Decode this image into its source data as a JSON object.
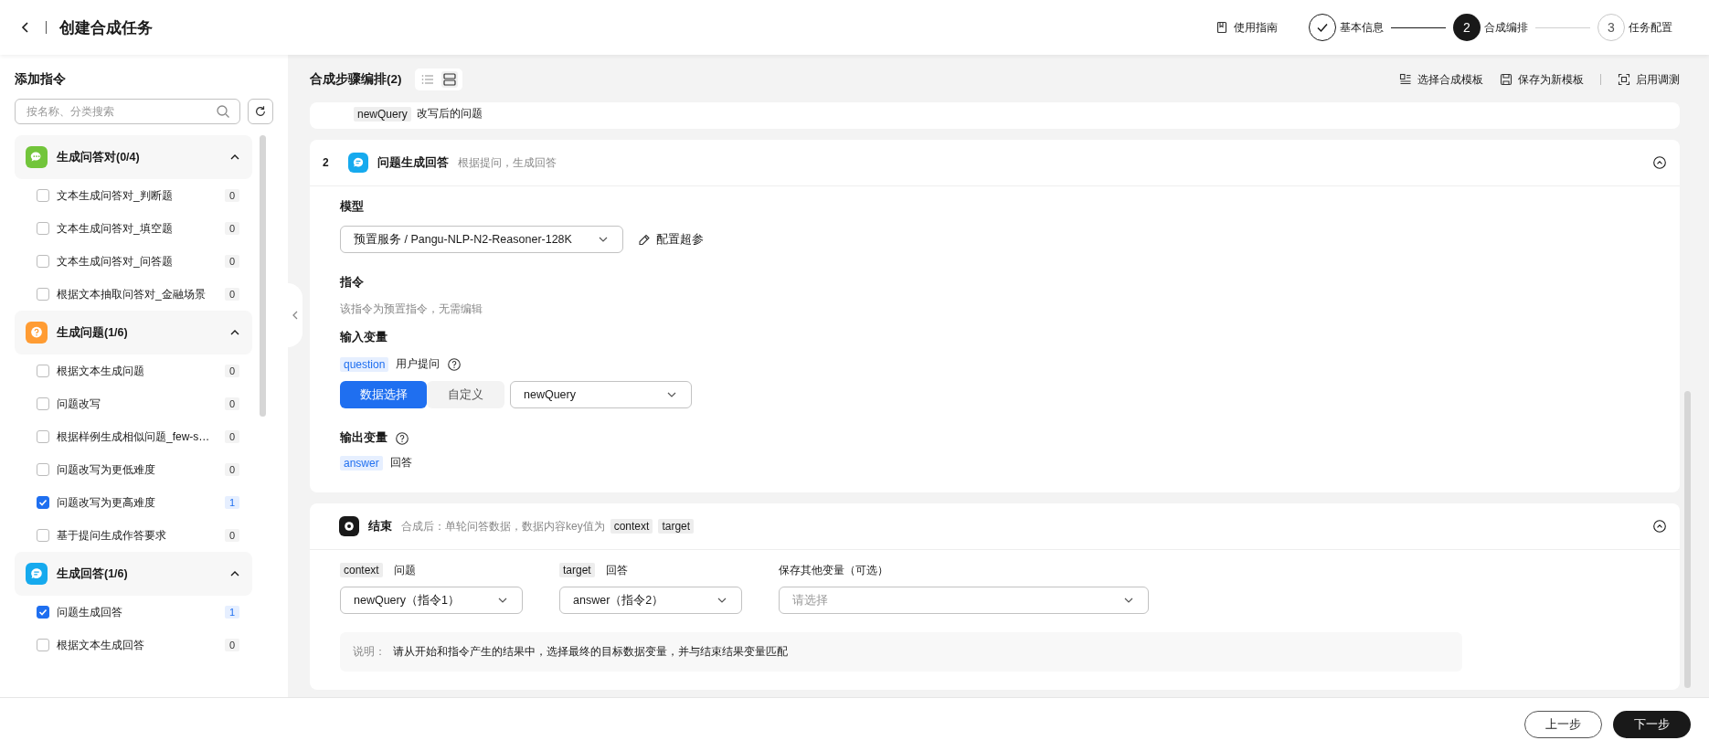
{
  "header": {
    "title": "创建合成任务",
    "guide_link": "使用指南",
    "steps": [
      {
        "label": "基本信息",
        "completed": true,
        "selected": false
      },
      {
        "number": "2",
        "label": "合成编排",
        "completed": false,
        "selected": true
      },
      {
        "number": "3",
        "label": "任务配置",
        "completed": false,
        "selected": false
      }
    ]
  },
  "sidebar": {
    "title": "添加指令",
    "search": {
      "placeholder": "按名称、分类搜索"
    },
    "groups": [
      {
        "title": "生成问答对(0/4)",
        "kind": "qa",
        "color": "#72c53b",
        "expanded": true,
        "items": [
          {
            "label": "文本生成问答对_判断题",
            "checked": false,
            "count": "0"
          },
          {
            "label": "文本生成问答对_填空题",
            "checked": false,
            "count": "0"
          },
          {
            "label": "文本生成问答对_问答题",
            "checked": false,
            "count": "0"
          },
          {
            "label": "根据文本抽取问答对_金融场景",
            "checked": false,
            "count": "0"
          }
        ]
      },
      {
        "title": "生成问题(1/6)",
        "kind": "question",
        "color": "#ff9c33",
        "expanded": true,
        "items": [
          {
            "label": "根据文本生成问题",
            "checked": false,
            "count": "0"
          },
          {
            "label": "问题改写",
            "checked": false,
            "count": "0"
          },
          {
            "label": "根据样例生成相似问题_few-s…",
            "checked": false,
            "count": "0"
          },
          {
            "label": "问题改写为更低难度",
            "checked": false,
            "count": "0"
          },
          {
            "label": "问题改写为更高难度",
            "checked": true,
            "count": "1"
          },
          {
            "label": "基于提问生成作答要求",
            "checked": false,
            "count": "0"
          }
        ]
      },
      {
        "title": "生成回答(1/6)",
        "kind": "answer",
        "color": "#16aaee",
        "expanded": true,
        "items": [
          {
            "label": "问题生成回答",
            "checked": true,
            "count": "1"
          },
          {
            "label": "根据文本生成回答",
            "checked": false,
            "count": "0"
          }
        ]
      }
    ]
  },
  "main": {
    "title": "合成步骤编排(2)",
    "views": [
      {
        "kind": "list",
        "selected": false
      },
      {
        "kind": "card",
        "selected": true
      }
    ],
    "actions": [
      {
        "label": "选择合成模板",
        "kind": "template"
      },
      {
        "label": "保存为新模板",
        "kind": "save"
      },
      {
        "label": "启用调测",
        "kind": "debug"
      }
    ],
    "previous_step": {
      "tag": "newQuery",
      "text": "改写后的问题"
    },
    "step": {
      "number": "2",
      "title": "问题生成回答",
      "description": "根据提问，生成回答",
      "expanded": true,
      "model_label": "模型",
      "model": "预置服务 / Pangu-NLP-N2-Reasoner-128K",
      "config_link": "配置超参",
      "instruction_label": "指令",
      "instruction_note": "该指令为预置指令，无需编辑",
      "input_label": "输入变量",
      "input": {
        "tag": "question",
        "name": "用户提问",
        "modes": [
          {
            "label": "数据选择",
            "selected": true
          },
          {
            "label": "自定义",
            "selected": false
          }
        ],
        "value": "newQuery"
      },
      "output_label": "输出变量",
      "output": {
        "tag": "answer",
        "name": "回答"
      }
    },
    "end": {
      "title": "结束",
      "description": "合成后：单轮问答数据，数据内容key值为",
      "tags": [
        "context",
        "target"
      ],
      "expanded": true,
      "fields": [
        {
          "tag": "context",
          "label": "问题",
          "value": "newQuery（指令1）"
        },
        {
          "tag": "target",
          "label": "回答",
          "value": "answer（指令2）"
        },
        {
          "label": "保存其他变量（可选）",
          "placeholder": "请选择"
        }
      ],
      "note_label": "说明：",
      "note": "请从开始和指令产生的结果中，选择最终的目标数据变量，并与结束结果变量匹配"
    }
  },
  "footer": {
    "buttons": [
      {
        "label": "上一步",
        "kind": "secondary"
      },
      {
        "label": "下一步",
        "kind": "primary"
      }
    ]
  }
}
